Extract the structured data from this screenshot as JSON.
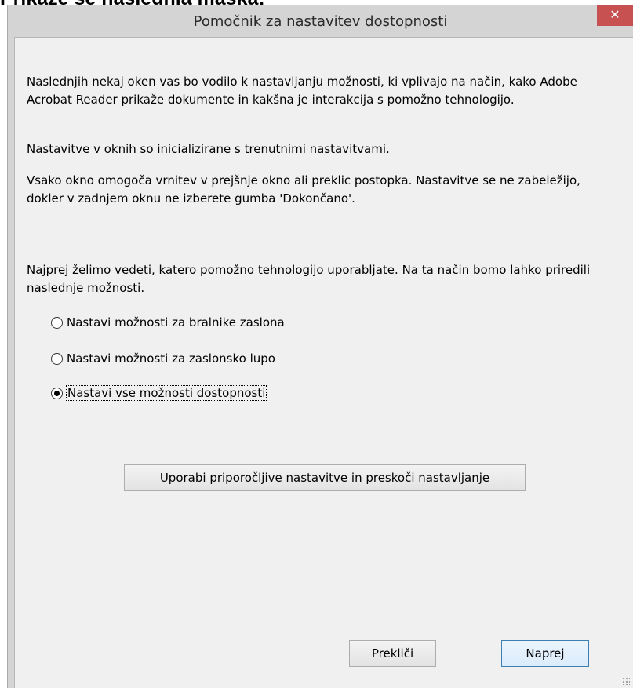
{
  "background_heading": "Prikaže se naslednja maska:",
  "window": {
    "title": "Pomočnik za nastavitev dostopnosti",
    "close_glyph": "✕"
  },
  "intro": {
    "p1": "Naslednjih nekaj oken vas bo vodilo k nastavljanju možnosti, ki vplivajo na način, kako Adobe Acrobat Reader prikaže dokumente in kakšna je interakcija s pomožno tehnologijo.",
    "p2": "Nastavitve v oknih so inicializirane s trenutnimi nastavitvami.",
    "p3": "Vsako okno omogoča vrnitev v prejšnje okno ali preklic postopka. Nastavitve se ne zabeležijo, dokler v zadnjem oknu ne izberete gumba 'Dokončano'."
  },
  "question": "Najprej želimo vedeti, katero pomožno tehnologijo uporabljate. Na ta način bomo lahko priredili naslednje možnosti.",
  "options": [
    {
      "label": "Nastavi možnosti za bralnike zaslona",
      "checked": false
    },
    {
      "label": "Nastavi možnosti za zaslonsko lupo",
      "checked": false
    },
    {
      "label": "Nastavi vse možnosti dostopnosti",
      "checked": true
    }
  ],
  "buttons": {
    "recommended": "Uporabi priporočljive nastavitve in preskoči nastavljanje",
    "cancel": "Prekliči",
    "next": "Naprej"
  },
  "colors": {
    "close_button": "#c75050",
    "window_frame": "#d4d4d4",
    "client_background": "#f0f0f0",
    "default_button_border": "#3c7fb1"
  }
}
